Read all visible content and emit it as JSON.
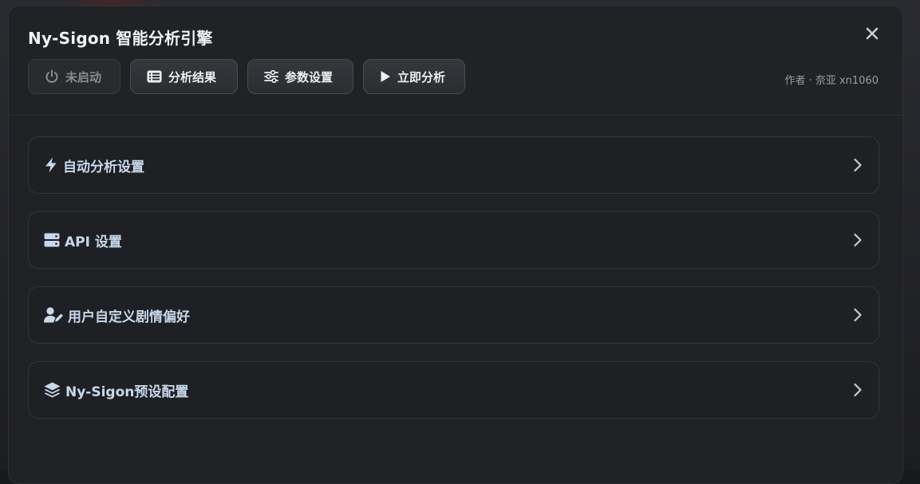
{
  "dialog": {
    "title": "Ny-Sigon 智能分析引擎",
    "author": "作者 · 奈亚 xn1060"
  },
  "toolbar": {
    "status_label": "未启动",
    "results_label": "分析结果",
    "params_label": "参数设置",
    "run_label": "立即分析"
  },
  "sections": [
    {
      "label": "自动分析设置",
      "icon": "bolt-icon"
    },
    {
      "label": "API 设置",
      "icon": "server-icon"
    },
    {
      "label": "用户自定义剧情偏好",
      "icon": "user-edit-icon"
    },
    {
      "label": "Ny-Sigon预设配置",
      "icon": "layers-icon"
    }
  ],
  "colors": {
    "panel_bg": "#212226",
    "section_label": "#c8d8ec",
    "button_bg": "#333438",
    "disabled_text": "#8a8c92"
  }
}
